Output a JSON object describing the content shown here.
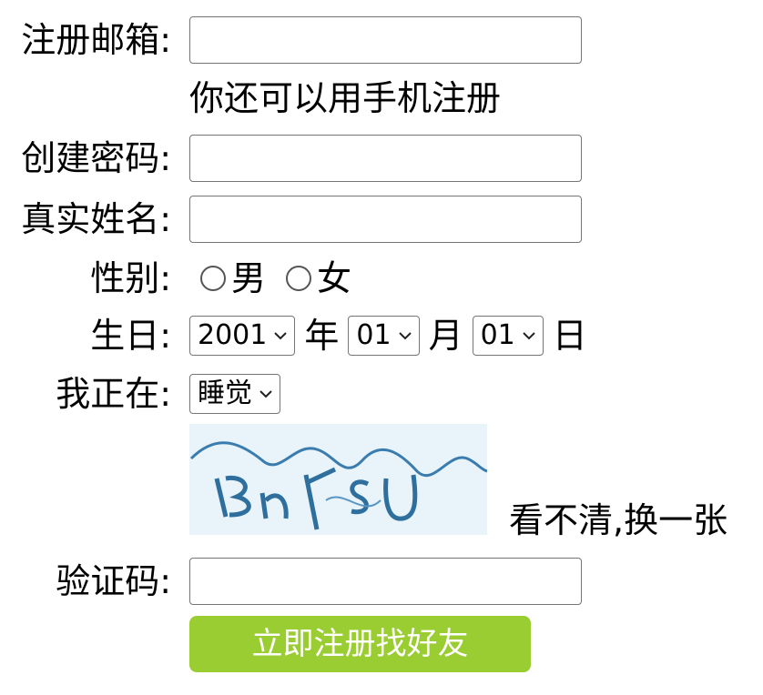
{
  "form": {
    "email": {
      "label": "注册邮箱:",
      "value": ""
    },
    "phone_hint": "你还可以用手机注册",
    "password": {
      "label": "创建密码:",
      "value": ""
    },
    "realname": {
      "label": "真实姓名:",
      "value": ""
    },
    "gender": {
      "label": "性别:",
      "options": [
        "男",
        "女"
      ]
    },
    "birthday": {
      "label": "生日:",
      "year": "2001",
      "year_unit": "年",
      "month": "01",
      "month_unit": "月",
      "day": "01",
      "day_unit": "日"
    },
    "status": {
      "label": "我正在:",
      "value": "睡觉"
    },
    "captcha": {
      "refresh_label": "看不清,换一张"
    },
    "verify": {
      "label": "验证码:",
      "value": ""
    },
    "submit_label": "立即注册找好友"
  },
  "colors": {
    "submit_bg": "#9acd32",
    "captcha_bg": "#e8f3fa",
    "captcha_ink": "#2e6f9e"
  },
  "icons": [
    "chevron-down-icon",
    "radio-icon"
  ]
}
